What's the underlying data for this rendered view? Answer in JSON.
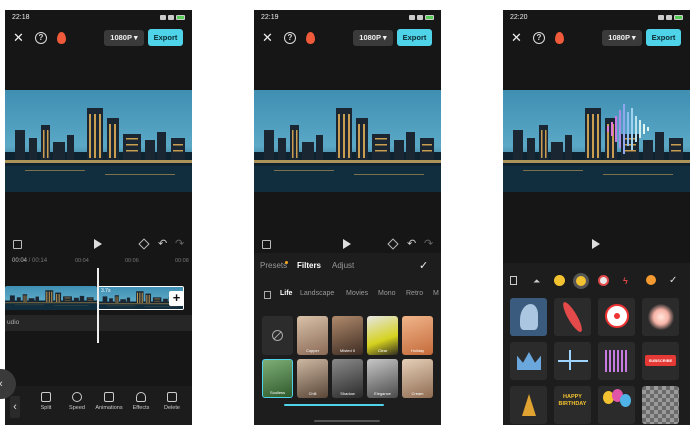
{
  "screens": [
    {
      "status_time": "22:18",
      "resolution": "1080P ▾",
      "export": "Export",
      "timecode_current": "00:04",
      "timecode_total": " / 00:14",
      "ruler": [
        "00:04",
        "00:06",
        "00:08"
      ],
      "clip_label": "3.7s",
      "audio_label": "udio",
      "tools": [
        "Split",
        "Speed",
        "Animations",
        "Effects",
        "Delete"
      ]
    },
    {
      "status_time": "22:19",
      "resolution": "1080P ▾",
      "export": "Export",
      "tabs": [
        "Presets",
        "Filters",
        "Adjust"
      ],
      "active_tab": "Filters",
      "categories": [
        "Life",
        "Landscape",
        "Movies",
        "Mono",
        "Retro",
        "M"
      ],
      "filters_row1": [
        "Copper",
        "Misted II",
        "Clear",
        "Holiday"
      ],
      "filters_row2": [
        "Soulless",
        "Chill",
        "Shadow",
        "Elegance",
        "Cream"
      ]
    },
    {
      "status_time": "22:20",
      "resolution": "1080P ▾",
      "export": "Export",
      "sticker_text_subscribe": "SUBSCRIBE",
      "sticker_text_birthday": "HAPPY BIRTHDAY"
    }
  ],
  "colors": {
    "accent": "#4fd3e8",
    "bg": "#161616",
    "fire": "#ef5a3a"
  }
}
